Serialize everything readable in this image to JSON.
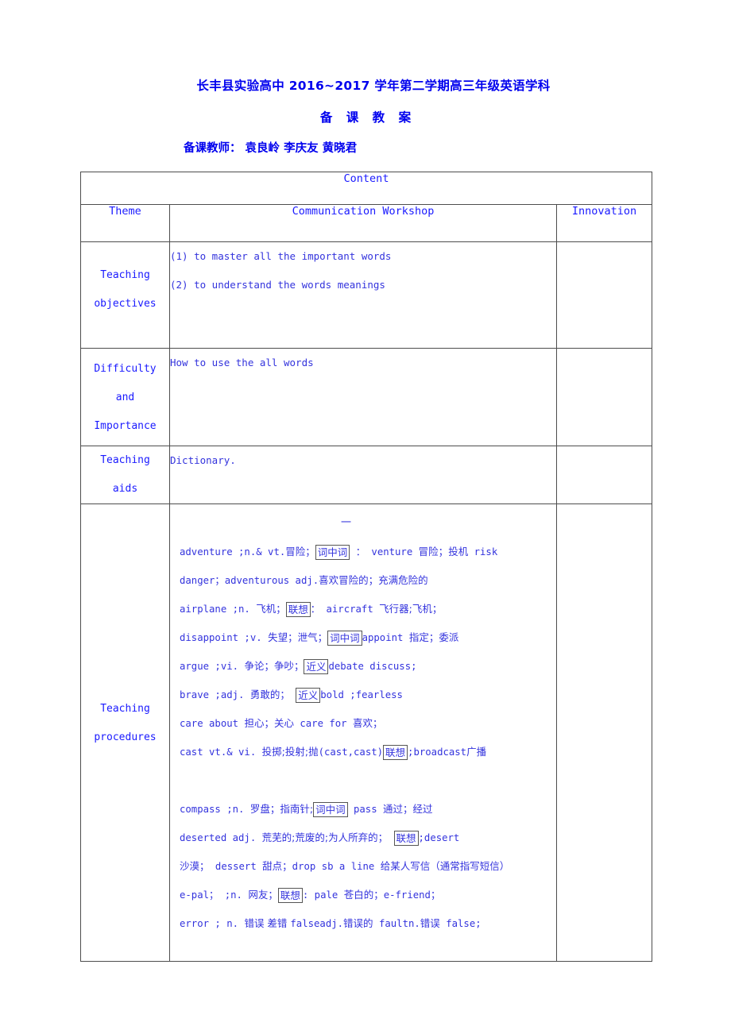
{
  "header": {
    "line1": "长丰县实验高中 2016~2017 学年第二学期高三年级英语学科",
    "line2": "备 课 教 案",
    "line3": "备课教师： 袁良岭 李庆友 黄晓君"
  },
  "table": {
    "content_header": "Content",
    "columns": {
      "theme": "Theme",
      "communication_workshop": "Communication Workshop",
      "innovation": "Innovation"
    },
    "rows": {
      "objectives": {
        "label_line1": "Teaching",
        "label_line2": "objectives",
        "items": [
          "(1) to master all the important words",
          "(2) to understand the words meanings"
        ],
        "innovation": ""
      },
      "difficulty": {
        "label_line1": "Difficulty",
        "label_line2": "and",
        "label_line3": "Importance",
        "items": [
          "How to use the all words"
        ],
        "innovation": ""
      },
      "aids": {
        "label_line1": "Teaching",
        "label_line2": "aids",
        "items": [
          "Dictionary."
        ],
        "innovation": ""
      },
      "procedures": {
        "label_line1": "Teaching",
        "label_line2": "procedures",
        "innovation": "",
        "heading_mark": "一",
        "vocabulary_lines": [
          "adventure    ;n.& vt.冒险；词中词 ： venture 冒险；投机 risk",
          "danger；adventurous adj.喜欢冒险的；充满危险的",
          "airplane    ;n. 飞机；联想： aircraft 飞行器;飞机；",
          "disappoint ;v. 失望；泄气；词中词 appoint 指定；委派",
          "argue  ;vi. 争论；争吵；近义 debate  discuss;",
          "brave   ;adj.   勇敢的； 近义 bold ;fearless",
          "care about 担心；关心 care for 喜欢；",
          "cast    vt.& vi. 投掷;投射;抛(cast,cast)联想;broadcast广播",
          "",
          "compass ;n. 罗盘；指南针;词中词 pass 通过；经过",
          "deserted     adj.    荒芜的;荒废的;为人所弃的； 联想;desert",
          "沙漠； dessert 甜点；drop sb a line 给某人写信（通常指写短信）",
          "e-pal； ;n. 网友；联想: pale 苍白的；e-friend；",
          "error    ; n.    错误 差错 false adj.错误的 fault n.错误 false;"
        ],
        "vocabulary_tokens": [
          [
            {
              "t": "adventure    ;n.& vt.",
              "k": "en"
            },
            {
              "t": "冒险",
              "k": "zh"
            },
            {
              "t": "；",
              "k": "zh"
            },
            {
              "t": "词中词",
              "k": "box"
            },
            {
              "t": " ： venture ",
              "k": "en"
            },
            {
              "t": "冒险",
              "k": "zh"
            },
            {
              "t": "；",
              "k": "zh"
            },
            {
              "t": "投机",
              "k": "zh"
            },
            {
              "t": " risk",
              "k": "en"
            }
          ],
          [
            {
              "t": "danger；adventurous adj.",
              "k": "en"
            },
            {
              "t": "喜欢冒险的；充满危险的",
              "k": "zh"
            }
          ],
          [
            {
              "t": "airplane    ;n. ",
              "k": "en"
            },
            {
              "t": "飞机",
              "k": "zh"
            },
            {
              "t": "；",
              "k": "zh"
            },
            {
              "t": "联想",
              "k": "box"
            },
            {
              "t": "： aircraft ",
              "k": "en"
            },
            {
              "t": "飞行器;飞机；",
              "k": "zh"
            }
          ],
          [
            {
              "t": "disappoint ;v. ",
              "k": "en"
            },
            {
              "t": "失望；泄气；",
              "k": "zh"
            },
            {
              "t": "词中词",
              "k": "box"
            },
            {
              "t": "appoint ",
              "k": "en"
            },
            {
              "t": "指定；委派",
              "k": "zh"
            }
          ],
          [
            {
              "t": "argue  ;vi. ",
              "k": "en"
            },
            {
              "t": "争论；争吵；",
              "k": "zh"
            },
            {
              "t": "近义",
              "k": "box"
            },
            {
              "t": "debate  discuss;",
              "k": "en"
            }
          ],
          [
            {
              "t": "brave   ;adj.   ",
              "k": "en"
            },
            {
              "t": "勇敢的；",
              "k": "zh"
            },
            {
              "t": " ",
              "k": "en"
            },
            {
              "t": "近义",
              "k": "box"
            },
            {
              "t": "bold ;fearless",
              "k": "en"
            }
          ],
          [
            {
              "t": "care about ",
              "k": "en"
            },
            {
              "t": "担心；关心",
              "k": "zh"
            },
            {
              "t": " care for ",
              "k": "en"
            },
            {
              "t": "喜欢；",
              "k": "zh"
            }
          ],
          [
            {
              "t": "cast    vt.& vi. ",
              "k": "en"
            },
            {
              "t": "投掷;投射;抛",
              "k": "zh"
            },
            {
              "t": "(cast,cast)",
              "k": "en"
            },
            {
              "t": "联想",
              "k": "box"
            },
            {
              "t": ";broadcast",
              "k": "en"
            },
            {
              "t": "广播",
              "k": "zh"
            }
          ],
          [],
          [
            {
              "t": "compass ;n. ",
              "k": "en"
            },
            {
              "t": "罗盘；指南针;",
              "k": "zh"
            },
            {
              "t": "词中词",
              "k": "box"
            },
            {
              "t": " pass ",
              "k": "en"
            },
            {
              "t": "通过；经过",
              "k": "zh"
            }
          ],
          [
            {
              "t": "deserted     adj.    ",
              "k": "en"
            },
            {
              "t": "荒芜的;荒废的;为人所弃的；",
              "k": "zh"
            },
            {
              "t": " ",
              "k": "en"
            },
            {
              "t": "联想",
              "k": "box"
            },
            {
              "t": ";desert",
              "k": "en"
            }
          ],
          [
            {
              "t": "沙漠；",
              "k": "zh"
            },
            {
              "t": " dessert ",
              "k": "en"
            },
            {
              "t": "甜点；",
              "k": "zh"
            },
            {
              "t": "drop sb a line ",
              "k": "en"
            },
            {
              "t": "给某人写信（通常指写短信）",
              "k": "zh"
            }
          ],
          [
            {
              "t": "e-pal； ;n. ",
              "k": "en"
            },
            {
              "t": "网友；",
              "k": "zh"
            },
            {
              "t": "联想",
              "k": "box"
            },
            {
              "t": ": pale ",
              "k": "en"
            },
            {
              "t": "苍白的；",
              "k": "zh"
            },
            {
              "t": "e-friend；",
              "k": "en"
            }
          ],
          [
            {
              "t": "error    ; n.    ",
              "k": "en"
            },
            {
              "t": "错误 差错 ",
              "k": "zh"
            },
            {
              "t": "false",
              "k": "en"
            },
            {
              "t": "adj.",
              "k": "en"
            },
            {
              "t": "错误的",
              "k": "zh"
            },
            {
              "t": " fault",
              "k": "en"
            },
            {
              "t": "n.",
              "k": "en"
            },
            {
              "t": "错误",
              "k": "zh"
            },
            {
              "t": " false;",
              "k": "en"
            }
          ]
        ]
      }
    }
  },
  "colors": {
    "text_blue": "#1a1aff",
    "body_blue": "#3333dd",
    "border": "#4d4d4d"
  }
}
